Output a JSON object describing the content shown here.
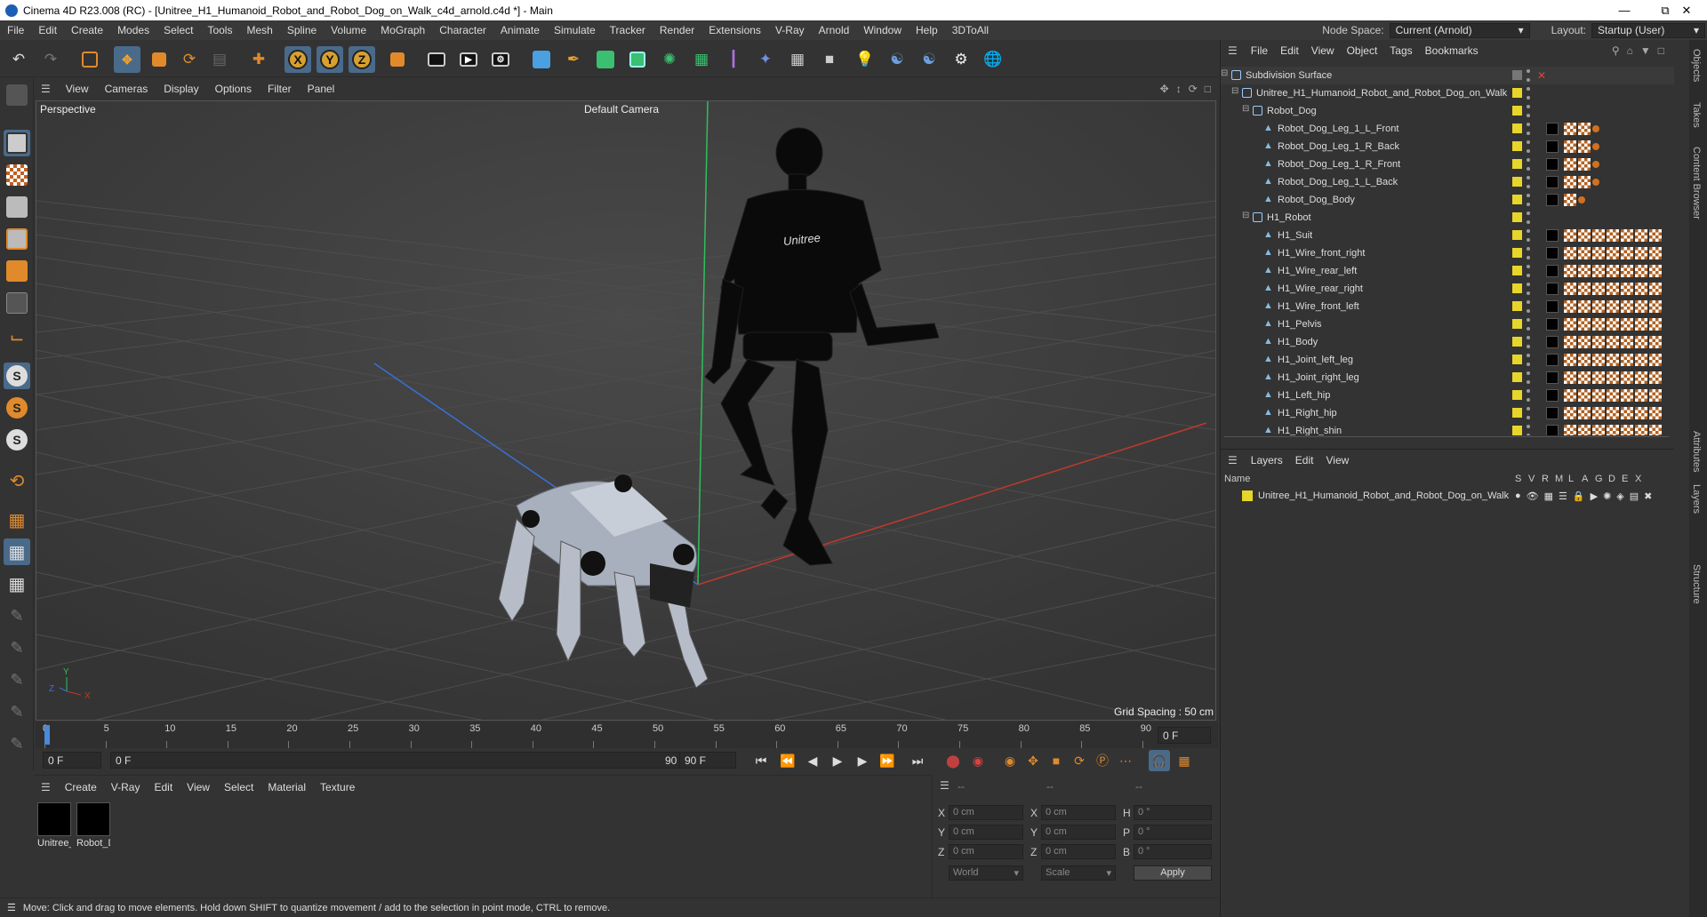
{
  "title": "Cinema 4D R23.008 (RC) - [Unitree_H1_Humanoid_Robot_and_Robot_Dog_on_Walk_c4d_arnold.c4d *] - Main",
  "menu": [
    "File",
    "Edit",
    "Create",
    "Modes",
    "Select",
    "Tools",
    "Mesh",
    "Spline",
    "Volume",
    "MoGraph",
    "Character",
    "Animate",
    "Simulate",
    "Tracker",
    "Render",
    "Extensions",
    "V-Ray",
    "Arnold",
    "Window",
    "Help",
    "3DToAll"
  ],
  "node_space_label": "Node Space:",
  "node_space_value": "Current (Arnold)",
  "layout_label": "Layout:",
  "layout_value": "Startup (User)",
  "viewport_menu": [
    "View",
    "Cameras",
    "Display",
    "Options",
    "Filter",
    "Panel"
  ],
  "viewport": {
    "name": "Perspective",
    "camera": "Default Camera",
    "grid_spacing": "Grid Spacing : 50 cm",
    "robot_logo": "Unitree"
  },
  "timeline_ticks": [
    "0",
    "5",
    "10",
    "15",
    "20",
    "25",
    "30",
    "35",
    "40",
    "45",
    "50",
    "55",
    "60",
    "65",
    "70",
    "75",
    "80",
    "85",
    "90"
  ],
  "timeline_end_field": "0 F",
  "transport": {
    "start": "0 F",
    "current": "0 F",
    "range_end": "90 F",
    "end": "90 F"
  },
  "material_menu": [
    "Create",
    "V-Ray",
    "Edit",
    "View",
    "Select",
    "Material",
    "Texture"
  ],
  "materials": [
    "Unitree_",
    "Robot_D"
  ],
  "coords": {
    "dash1": "--",
    "dash2": "--",
    "dash3": "--",
    "x": "0 cm",
    "y": "0 cm",
    "z": "0 cm",
    "sx": "0 cm",
    "sy": "0 cm",
    "sz": "0 cm",
    "h": "0 °",
    "p": "0 °",
    "b": "0 °",
    "mode1": "World",
    "mode2": "Scale",
    "apply": "Apply"
  },
  "status": "Move: Click and drag to move elements. Hold down SHIFT to quantize movement / add to the selection in point mode, CTRL to remove.",
  "obj_menu": [
    "File",
    "Edit",
    "View",
    "Object",
    "Tags",
    "Bookmarks"
  ],
  "objects": [
    {
      "name": "Subdivision Surface",
      "indent": 0,
      "tags": 0
    },
    {
      "name": "Unitree_H1_Humanoid_Robot_and_Robot_Dog_on_Walk",
      "indent": 1,
      "tags": 0
    },
    {
      "name": "Robot_Dog",
      "indent": 2,
      "tags": 0
    },
    {
      "name": "Robot_Dog_Leg_1_L_Front",
      "indent": 3,
      "tags": 3
    },
    {
      "name": "Robot_Dog_Leg_1_R_Back",
      "indent": 3,
      "tags": 3
    },
    {
      "name": "Robot_Dog_Leg_1_R_Front",
      "indent": 3,
      "tags": 3
    },
    {
      "name": "Robot_Dog_Leg_1_L_Back",
      "indent": 3,
      "tags": 3
    },
    {
      "name": "Robot_Dog_Body",
      "indent": 3,
      "tags": 2
    },
    {
      "name": "H1_Robot",
      "indent": 2,
      "tags": 0
    },
    {
      "name": "H1_Suit",
      "indent": 3,
      "tags": 7
    },
    {
      "name": "H1_Wire_front_right",
      "indent": 3,
      "tags": 7
    },
    {
      "name": "H1_Wire_rear_left",
      "indent": 3,
      "tags": 7
    },
    {
      "name": "H1_Wire_rear_right",
      "indent": 3,
      "tags": 7
    },
    {
      "name": "H1_Wire_front_left",
      "indent": 3,
      "tags": 7
    },
    {
      "name": "H1_Pelvis",
      "indent": 3,
      "tags": 7
    },
    {
      "name": "H1_Body",
      "indent": 3,
      "tags": 7
    },
    {
      "name": "H1_Joint_left_leg",
      "indent": 3,
      "tags": 7
    },
    {
      "name": "H1_Joint_right_leg",
      "indent": 3,
      "tags": 7
    },
    {
      "name": "H1_Left_hip",
      "indent": 3,
      "tags": 7
    },
    {
      "name": "H1_Right_hip",
      "indent": 3,
      "tags": 7
    },
    {
      "name": "H1_Right_shin",
      "indent": 3,
      "tags": 7
    }
  ],
  "layers_menu": [
    "Layers",
    "Edit",
    "View"
  ],
  "layers_header": {
    "name": "Name",
    "cols": [
      "S",
      "V",
      "R",
      "M",
      "L",
      "A",
      "G",
      "D",
      "E",
      "X"
    ]
  },
  "layer_row": "Unitree_H1_Humanoid_Robot_and_Robot_Dog_on_Walk",
  "side_tabs": [
    "Objects",
    "Takes",
    "Content Browser",
    "Attributes",
    "Layers",
    "Structure"
  ]
}
